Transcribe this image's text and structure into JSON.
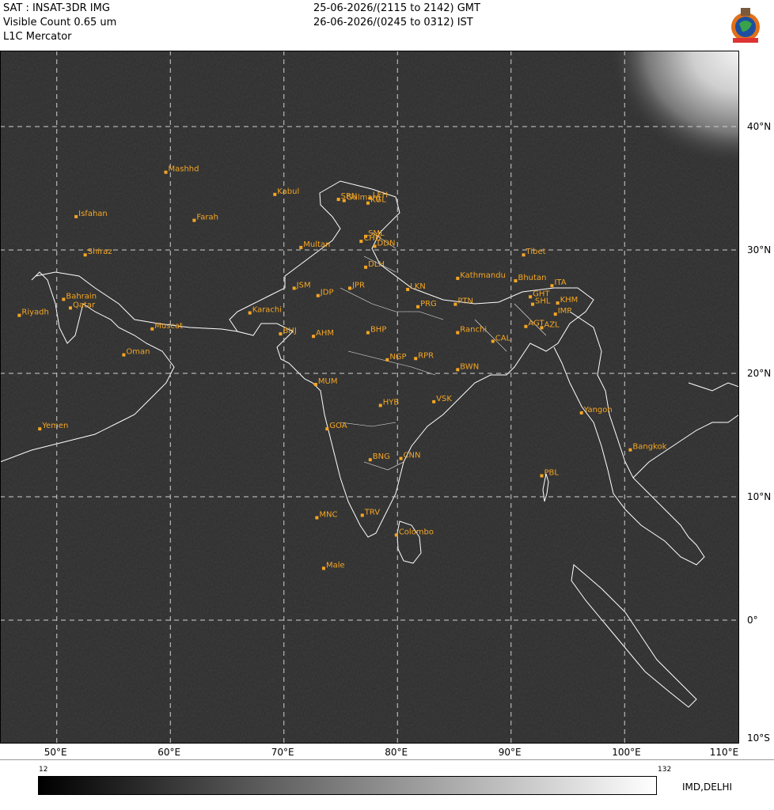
{
  "header": {
    "line1": "SAT : INSAT-3DR IMG",
    "line2": "Visible Count 0.65 um",
    "line3": "L1C Mercator",
    "time_gmt": "25-06-2026/(2115 to 2142) GMT",
    "time_ist": "26-06-2026/(0245 to 0312) IST"
  },
  "colors": {
    "land_border": "#ffffff",
    "label": "#f5a623",
    "grid": "#d0d0d0",
    "background": "#2b2b2b"
  },
  "lon_ticks": [
    "50°E",
    "60°E",
    "70°E",
    "80°E",
    "90°E",
    "100°E",
    "110°E"
  ],
  "lat_ticks": [
    "40°N",
    "30°N",
    "20°N",
    "10°N",
    "0°",
    "10°S"
  ],
  "extent": {
    "lon": [
      45,
      110
    ],
    "lat": [
      -10,
      45
    ]
  },
  "stations": [
    {
      "name": "Mashhd",
      "lon": 59.6,
      "lat": 36.3
    },
    {
      "name": "Kabul",
      "lon": 69.2,
      "lat": 34.5
    },
    {
      "name": "SRN",
      "lon": 74.8,
      "lat": 34.1
    },
    {
      "name": "Gulmarg",
      "lon": 75.3,
      "lat": 34.0
    },
    {
      "name": "LEH",
      "lon": 77.6,
      "lat": 34.2
    },
    {
      "name": "KGL",
      "lon": 77.4,
      "lat": 33.8
    },
    {
      "name": "Isfahan",
      "lon": 51.7,
      "lat": 32.7
    },
    {
      "name": "Farah",
      "lon": 62.1,
      "lat": 32.4
    },
    {
      "name": "SML",
      "lon": 77.2,
      "lat": 31.1
    },
    {
      "name": "CHD",
      "lon": 76.8,
      "lat": 30.7
    },
    {
      "name": "DDN",
      "lon": 78.0,
      "lat": 30.3
    },
    {
      "name": "Multan",
      "lon": 71.5,
      "lat": 30.2
    },
    {
      "name": "Shiraz",
      "lon": 52.5,
      "lat": 29.6
    },
    {
      "name": "Tibet",
      "lon": 91.1,
      "lat": 29.6
    },
    {
      "name": "DLH",
      "lon": 77.2,
      "lat": 28.6
    },
    {
      "name": "Kathmandu",
      "lon": 85.3,
      "lat": 27.7
    },
    {
      "name": "Bhutan",
      "lon": 90.4,
      "lat": 27.5
    },
    {
      "name": "ITA",
      "lon": 93.6,
      "lat": 27.1
    },
    {
      "name": "JSM",
      "lon": 70.9,
      "lat": 26.9
    },
    {
      "name": "JPR",
      "lon": 75.8,
      "lat": 26.9
    },
    {
      "name": "LKN",
      "lon": 80.9,
      "lat": 26.8
    },
    {
      "name": "JDP",
      "lon": 73.0,
      "lat": 26.3
    },
    {
      "name": "GHT",
      "lon": 91.7,
      "lat": 26.2
    },
    {
      "name": "Bahrain",
      "lon": 50.6,
      "lat": 26.0
    },
    {
      "name": "PTN",
      "lon": 85.1,
      "lat": 25.6
    },
    {
      "name": "SHL",
      "lon": 91.9,
      "lat": 25.6
    },
    {
      "name": "KHM",
      "lon": 94.1,
      "lat": 25.7
    },
    {
      "name": "Qatar",
      "lon": 51.2,
      "lat": 25.3
    },
    {
      "name": "PRG",
      "lon": 81.8,
      "lat": 25.4
    },
    {
      "name": "Karachi",
      "lon": 67.0,
      "lat": 24.9
    },
    {
      "name": "IMP",
      "lon": 93.9,
      "lat": 24.8
    },
    {
      "name": "Riyadh",
      "lon": 46.7,
      "lat": 24.7
    },
    {
      "name": "AGT",
      "lon": 91.3,
      "lat": 23.8
    },
    {
      "name": "AZL",
      "lon": 92.7,
      "lat": 23.7
    },
    {
      "name": "Muscat",
      "lon": 58.4,
      "lat": 23.6
    },
    {
      "name": "Ranchi",
      "lon": 85.3,
      "lat": 23.3
    },
    {
      "name": "BHJ",
      "lon": 69.7,
      "lat": 23.2
    },
    {
      "name": "BHP",
      "lon": 77.4,
      "lat": 23.3
    },
    {
      "name": "AHM",
      "lon": 72.6,
      "lat": 23.0
    },
    {
      "name": "CAL",
      "lon": 88.4,
      "lat": 22.6
    },
    {
      "name": "Oman",
      "lon": 55.9,
      "lat": 21.5
    },
    {
      "name": "NGP",
      "lon": 79.1,
      "lat": 21.1
    },
    {
      "name": "RPR",
      "lon": 81.6,
      "lat": 21.2
    },
    {
      "name": "BWN",
      "lon": 85.3,
      "lat": 20.3
    },
    {
      "name": "MUM",
      "lon": 72.8,
      "lat": 19.1
    },
    {
      "name": "VSK",
      "lon": 83.2,
      "lat": 17.7
    },
    {
      "name": "HYB",
      "lon": 78.5,
      "lat": 17.4
    },
    {
      "name": "Yangon",
      "lon": 96.2,
      "lat": 16.8
    },
    {
      "name": "Yemen",
      "lon": 48.5,
      "lat": 15.5
    },
    {
      "name": "GOA",
      "lon": 73.8,
      "lat": 15.5
    },
    {
      "name": "Bangkok",
      "lon": 100.5,
      "lat": 13.8
    },
    {
      "name": "BNG",
      "lon": 77.6,
      "lat": 13.0
    },
    {
      "name": "CNN",
      "lon": 80.3,
      "lat": 13.1
    },
    {
      "name": "PBL",
      "lon": 92.7,
      "lat": 11.7
    },
    {
      "name": "MNC",
      "lon": 72.9,
      "lat": 8.3
    },
    {
      "name": "TRV",
      "lon": 76.9,
      "lat": 8.5
    },
    {
      "name": "Colombo",
      "lon": 79.9,
      "lat": 6.9
    },
    {
      "name": "Male",
      "lon": 73.5,
      "lat": 4.2
    }
  ],
  "colorbar": {
    "min_label": "12",
    "max_label": "132"
  },
  "credit": "IMD,DELHI"
}
